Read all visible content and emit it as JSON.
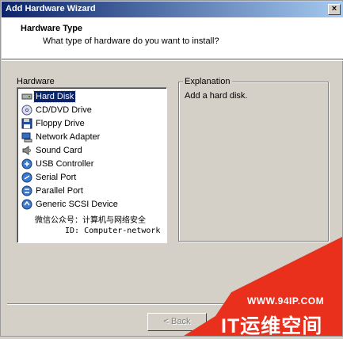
{
  "window": {
    "title": "Add Hardware Wizard",
    "close_glyph": "×"
  },
  "header": {
    "title": "Hardware Type",
    "subtitle": "What type of hardware do you want to install?"
  },
  "hardware": {
    "label": "Hardware",
    "selected": "Hard Disk",
    "items": [
      {
        "label": "Hard Disk",
        "icon": "hard-disk-icon"
      },
      {
        "label": "CD/DVD Drive",
        "icon": "cd-dvd-icon"
      },
      {
        "label": "Floppy Drive",
        "icon": "floppy-icon"
      },
      {
        "label": "Network Adapter",
        "icon": "network-adapter-icon"
      },
      {
        "label": "Sound Card",
        "icon": "speaker-icon"
      },
      {
        "label": "USB Controller",
        "icon": "usb-icon"
      },
      {
        "label": "Serial Port",
        "icon": "serial-port-icon"
      },
      {
        "label": "Parallel Port",
        "icon": "parallel-port-icon"
      },
      {
        "label": "Generic SCSI Device",
        "icon": "scsi-icon"
      }
    ],
    "watermark_line1": "微信公众号：计算机与网络安全",
    "watermark_line2": "ID: Computer-network"
  },
  "explanation": {
    "label": "Explanation",
    "text": "Add a hard disk."
  },
  "buttons": {
    "back_label": "< Back"
  },
  "watermark": {
    "url": "WWW.94IP.COM",
    "brand": "IT运维空间",
    "banner_color": "#e8301c"
  }
}
